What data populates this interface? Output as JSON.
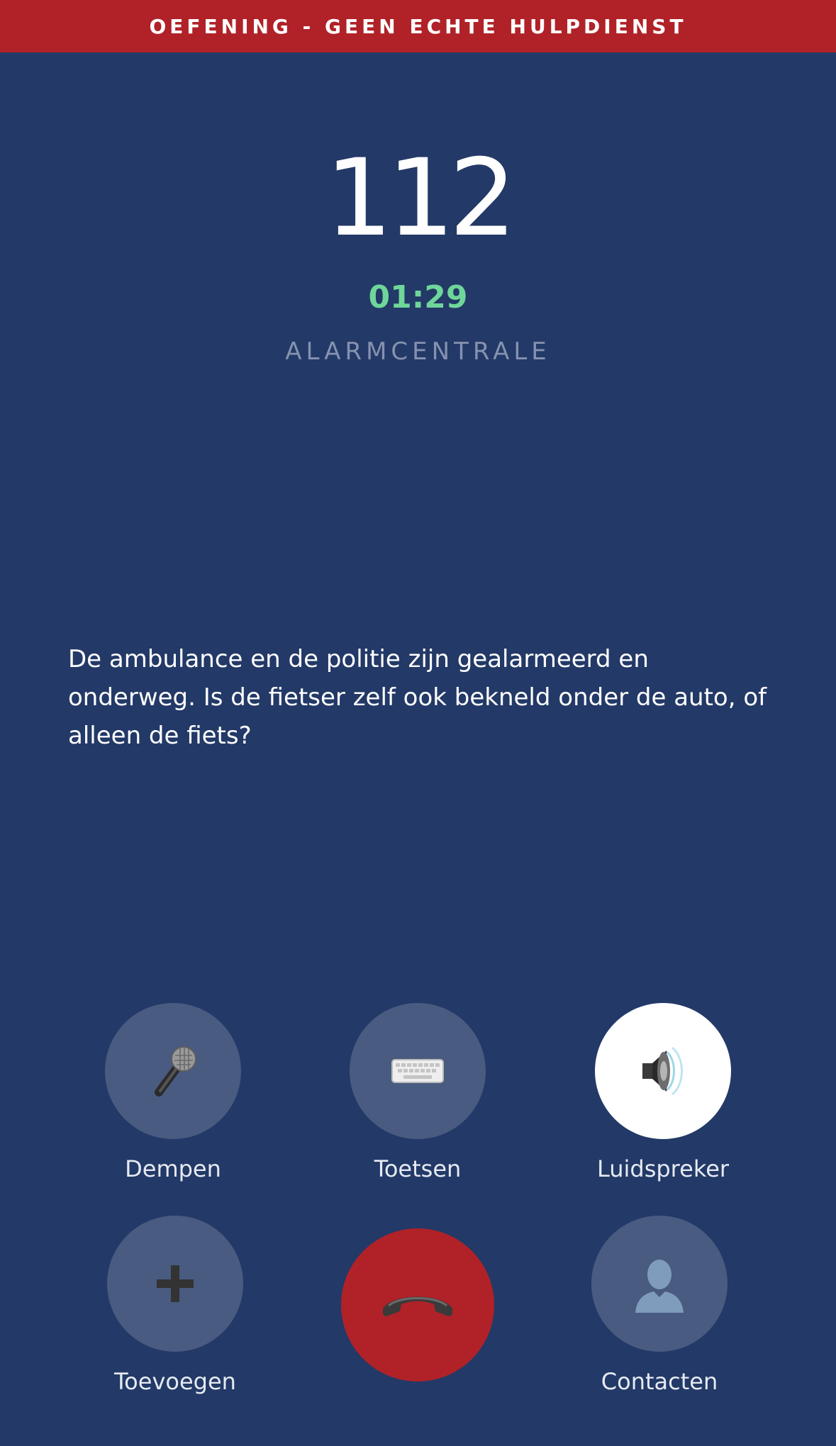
{
  "banner": {
    "text": "OEFENING - GEEN ECHTE HULPDIENST"
  },
  "call": {
    "number": "112",
    "duration": "01:29",
    "caller_label": "ALARMCENTRALE"
  },
  "message": "De ambulance en de politie zijn gealarmeerd en onderweg. Is de fietser zelf ook bekneld onder de auto, of alleen de fiets?",
  "controls": {
    "mute": {
      "label": "Dempen",
      "icon": "microphone-icon",
      "active": false
    },
    "keypad": {
      "label": "Toetsen",
      "icon": "keyboard-icon",
      "active": false
    },
    "speaker": {
      "label": "Luidspreker",
      "icon": "speaker-icon",
      "active": true
    },
    "add": {
      "label": "Toevoegen",
      "icon": "plus-icon",
      "active": false
    },
    "end": {
      "icon": "end-call-icon"
    },
    "contacts": {
      "label": "Contacten",
      "icon": "contact-icon",
      "active": false
    }
  },
  "colors": {
    "background": "#233967",
    "banner": "#b02228",
    "timer": "#6fd69a",
    "button": "#495b80",
    "end_call": "#b02228"
  }
}
